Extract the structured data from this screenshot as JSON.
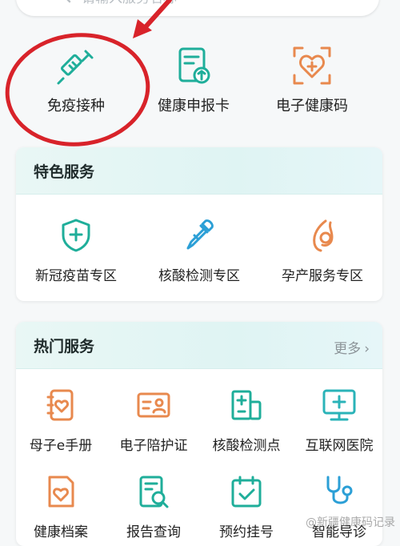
{
  "search": {
    "placeholder": "请输入服务名称"
  },
  "top_services": [
    {
      "label": "免疫接种",
      "icon": "syringe-icon"
    },
    {
      "label": "健康申报卡",
      "icon": "health-declaration-card-icon"
    },
    {
      "label": "电子健康码",
      "icon": "heart-health-code-icon"
    }
  ],
  "featured": {
    "title": "特色服务",
    "items": [
      {
        "label": "新冠疫苗专区",
        "icon": "shield-plus-icon"
      },
      {
        "label": "核酸检测专区",
        "icon": "pipette-icon"
      },
      {
        "label": "孕产服务专区",
        "icon": "pregnancy-icon"
      }
    ]
  },
  "popular": {
    "title": "热门服务",
    "more_label": "更多",
    "items": [
      {
        "label": "母子e手册",
        "icon": "heart-notebook-icon"
      },
      {
        "label": "电子陪护证",
        "icon": "id-card-icon"
      },
      {
        "label": "核酸检测点",
        "icon": "hospital-icon"
      },
      {
        "label": "互联网医院",
        "icon": "monitor-cross-icon"
      },
      {
        "label": "健康档案",
        "icon": "health-record-icon"
      },
      {
        "label": "报告查询",
        "icon": "report-search-icon"
      },
      {
        "label": "预约挂号",
        "icon": "calendar-check-icon"
      },
      {
        "label": "智能导诊",
        "icon": "stethoscope-icon"
      }
    ]
  },
  "watermark": "@新疆健康码记录",
  "colors": {
    "teal": "#1fae9a",
    "orange": "#e8894e",
    "blue": "#2b9fd6",
    "annotation_red": "#d8232a"
  }
}
